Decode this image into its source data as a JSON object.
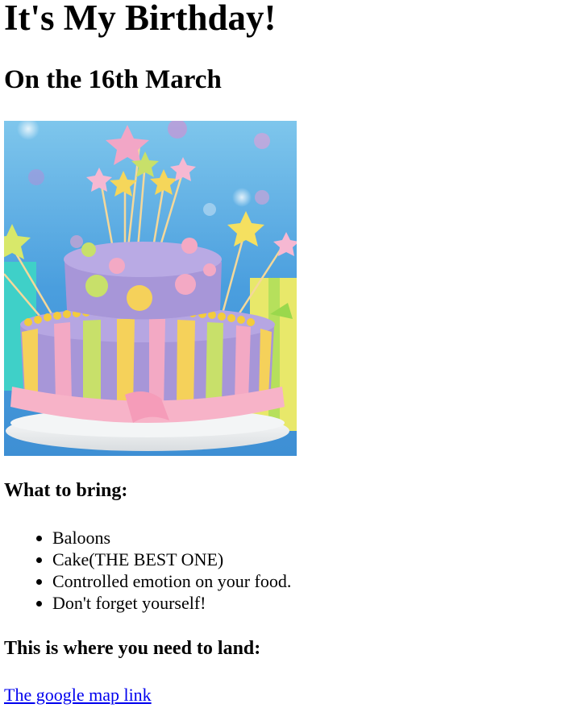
{
  "heading": "It's My Birthday!",
  "date_heading": "On the 16th March",
  "bring_heading": "What to bring:",
  "bring_items": [
    "Baloons",
    "Cake(THE BEST ONE)",
    "Controlled emotion on your food.",
    "Don't forget yourself!"
  ],
  "land_heading": "This is where you need to land:",
  "map_link_text": "The google map link",
  "colors": {
    "link": "#0000ee",
    "cake_purple": "#a796d8",
    "background_blue": "#58a8df"
  }
}
